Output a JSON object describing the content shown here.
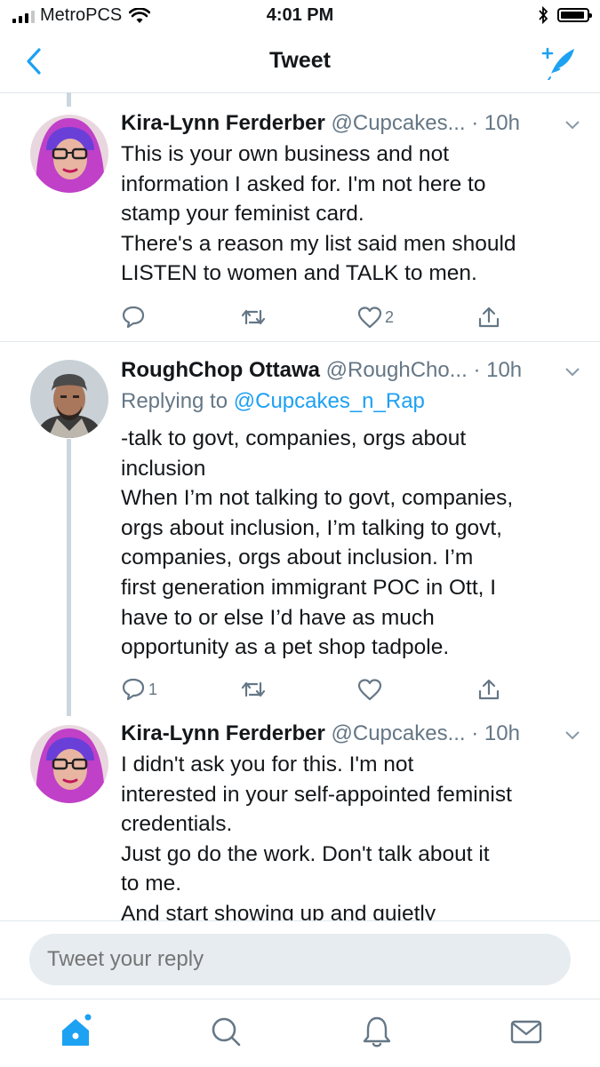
{
  "status": {
    "carrier": "MetroPCS",
    "time": "4:01 PM"
  },
  "nav": {
    "title": "Tweet"
  },
  "tweets": [
    {
      "name": "Kira-Lynn Ferderber",
      "handle": "@Cupcakes...",
      "time": "· 10h",
      "reply_to_label": "",
      "reply_to": "",
      "lines": [
        "This is your own business and not",
        "information I asked for. I'm not here to",
        "stamp your feminist card.",
        "There's a reason my list said men should",
        "LISTEN to women and TALK to men."
      ],
      "replies": "",
      "retweets": "",
      "likes": "2"
    },
    {
      "name": "RoughChop Ottawa",
      "handle": "@RoughCho...",
      "time": "· 10h",
      "reply_to_label": "Replying to",
      "reply_to": "@Cupcakes_n_Rap",
      "lines": [
        "-talk to govt, companies, orgs about",
        "inclusion",
        "When I’m not talking to govt, companies,",
        "orgs about inclusion, I’m talking to govt,",
        "companies, orgs about inclusion.  I’m",
        "first generation immigrant POC in Ott, I",
        "have to or else I’d have as much",
        "opportunity as a pet shop tadpole."
      ],
      "replies": "1",
      "retweets": "",
      "likes": ""
    },
    {
      "name": "Kira-Lynn Ferderber",
      "handle": "@Cupcakes...",
      "time": "· 10h",
      "reply_to_label": "",
      "reply_to": "",
      "lines": [
        "I didn't ask you for this. I'm not",
        "interested in your self-appointed feminist",
        "credentials.",
        "Just go do the work. Don't talk about it",
        "to me.",
        "And start showing up and quietly"
      ],
      "replies": "",
      "retweets": "",
      "likes": ""
    }
  ],
  "reply_box": {
    "placeholder": "Tweet your reply"
  },
  "colors": {
    "accent": "#1da1f2",
    "muted": "#657786",
    "thread": "#ccd6dd"
  }
}
